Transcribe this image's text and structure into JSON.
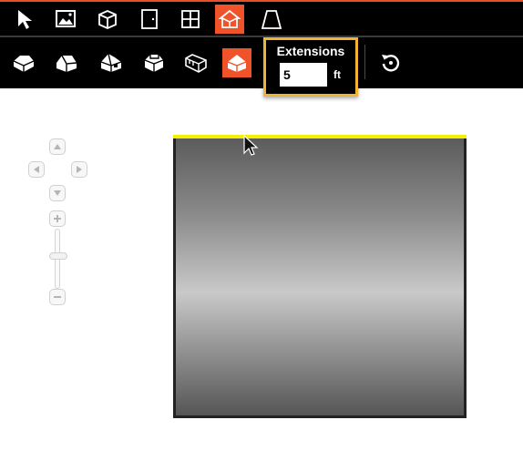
{
  "colors": {
    "accent": "#f0532a",
    "highlight": "#f2b233",
    "ridge": "#f5f000",
    "toolbar": "#000000"
  },
  "toolbar_top": {
    "tools": [
      {
        "icon": "pointer-icon",
        "active": false
      },
      {
        "icon": "image-icon",
        "active": false
      },
      {
        "icon": "cube-icon",
        "active": false
      },
      {
        "icon": "door-icon",
        "active": false
      },
      {
        "icon": "window-icon",
        "active": false
      },
      {
        "icon": "roof-icon",
        "active": true
      },
      {
        "icon": "trapezoid-icon",
        "active": false
      }
    ]
  },
  "toolbar_bottom": {
    "roof_styles": [
      {
        "icon": "hip-roof-icon",
        "active": false
      },
      {
        "icon": "gable-roof-icon",
        "active": false
      },
      {
        "icon": "gable-dormer-roof-icon",
        "active": false
      },
      {
        "icon": "dutch-roof-icon",
        "active": false
      },
      {
        "icon": "flat-parapet-roof-icon",
        "active": false
      },
      {
        "icon": "roof-extension-icon",
        "active": true
      }
    ],
    "extensions": {
      "label": "Extensions",
      "value": "5",
      "unit": "ft"
    },
    "reset_icon": "reset-icon"
  },
  "navigation": {
    "pan_icons": [
      "pan-up-icon",
      "pan-left-icon",
      "pan-right-icon",
      "pan-down-icon"
    ],
    "zoom_in_icon": "zoom-in-icon",
    "zoom_out_icon": "zoom-out-icon"
  }
}
